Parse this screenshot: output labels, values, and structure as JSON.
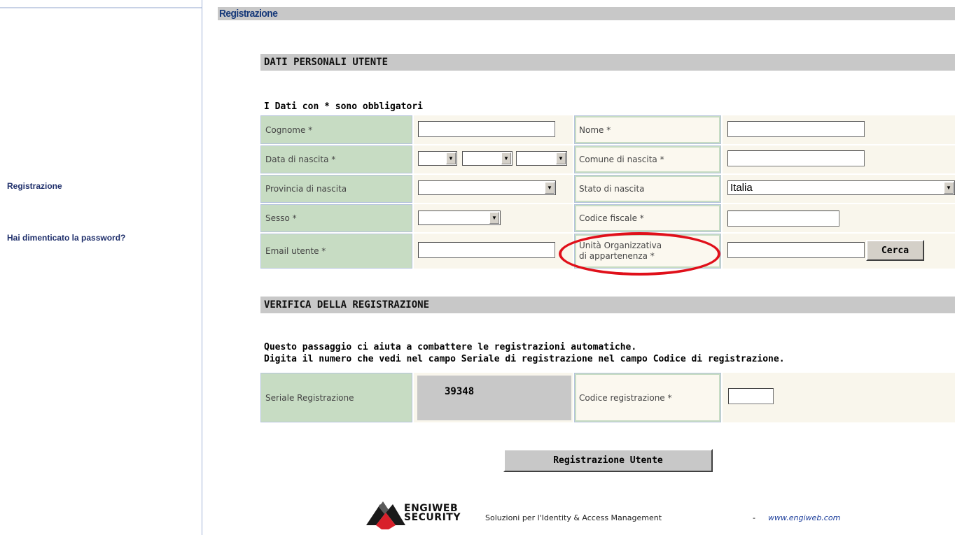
{
  "sidebar": {
    "links": [
      {
        "label": "Registrazione"
      },
      {
        "label": "Hai dimenticato la password?"
      }
    ]
  },
  "page": {
    "title": "Registrazione"
  },
  "sections": {
    "personal": "DATI PERSONALI UTENTE",
    "verify": "VERIFICA DELLA REGISTRAZIONE"
  },
  "form": {
    "required_note": "I Dati con * sono obbligatori",
    "cognome_label": "Cognome *",
    "cognome_value": "",
    "nome_label": "Nome *",
    "nome_value": "",
    "data_nascita_label": "Data di nascita *",
    "data_nascita_day": "",
    "data_nascita_month": "",
    "data_nascita_year": "",
    "comune_label": "Comune di nascita *",
    "comune_value": "",
    "provincia_label": "Provincia di nascita",
    "provincia_value": "",
    "stato_label": "Stato di nascita",
    "stato_value": "Italia",
    "sesso_label": "Sesso *",
    "sesso_value": "",
    "codice_fiscale_label": "Codice fiscale *",
    "codice_fiscale_value": "",
    "email_label": "Email utente *",
    "email_value": "",
    "unita_label_line1": "Unità Organizzativa",
    "unita_label_line2": "di appartenenza *",
    "unita_value": "",
    "cerca_label": "Cerca"
  },
  "verify": {
    "note_line1": "Questo passaggio ci aiuta a combattere le registrazioni automatiche.",
    "note_line2": "Digita il numero che vedi nel campo Seriale di registrazione nel campo Codice di registrazione.",
    "serial_label": "Seriale Registrazione",
    "serial_value": "39348",
    "code_label": "Codice registrazione *",
    "code_value": ""
  },
  "submit_label": "Registrazione Utente",
  "footer": {
    "logo_word1": "ENGIWEB",
    "logo_word2": "SECURITY",
    "tagline": "Soluzioni per l'Identity & Access Management",
    "dash": "-",
    "link": "www.engiweb.com"
  },
  "colors": {
    "label_bg": "#c7dcc3",
    "value_bg": "#f9f6ec",
    "header_bg": "#c8c8c8",
    "highlight": "#e0101a",
    "sidebar_link": "#1f2f6b"
  }
}
